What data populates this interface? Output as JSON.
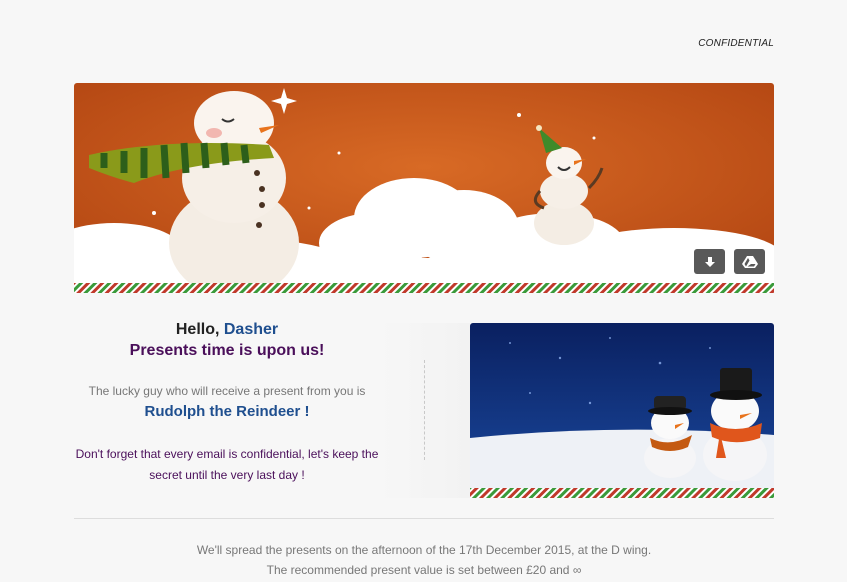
{
  "header": {
    "confidential_label": "CONFIDENTIAL"
  },
  "banner": {
    "download_button": "download-icon",
    "drive_button": "google-drive-icon"
  },
  "message": {
    "greeting": "Hello,",
    "name": "Dasher",
    "tagline": "Presents time is upon us!",
    "lucky_text": "The lucky guy who will receive a present from you is",
    "recipient": "Rudolph the Reindeer !",
    "reminder": "Don't forget that every email is confidential, let's keep the secret until the very last day !"
  },
  "footer": {
    "line1": "We'll spread the presents on the afternoon of the 17th December 2015, at the D wing.",
    "line2": "The recommended present value is set between £20 and ∞"
  },
  "colors": {
    "background": "#f7f7f7",
    "banner_orange": "#c8561a",
    "name_blue": "#1f4f8f",
    "tagline_purple": "#4a0f5a"
  }
}
